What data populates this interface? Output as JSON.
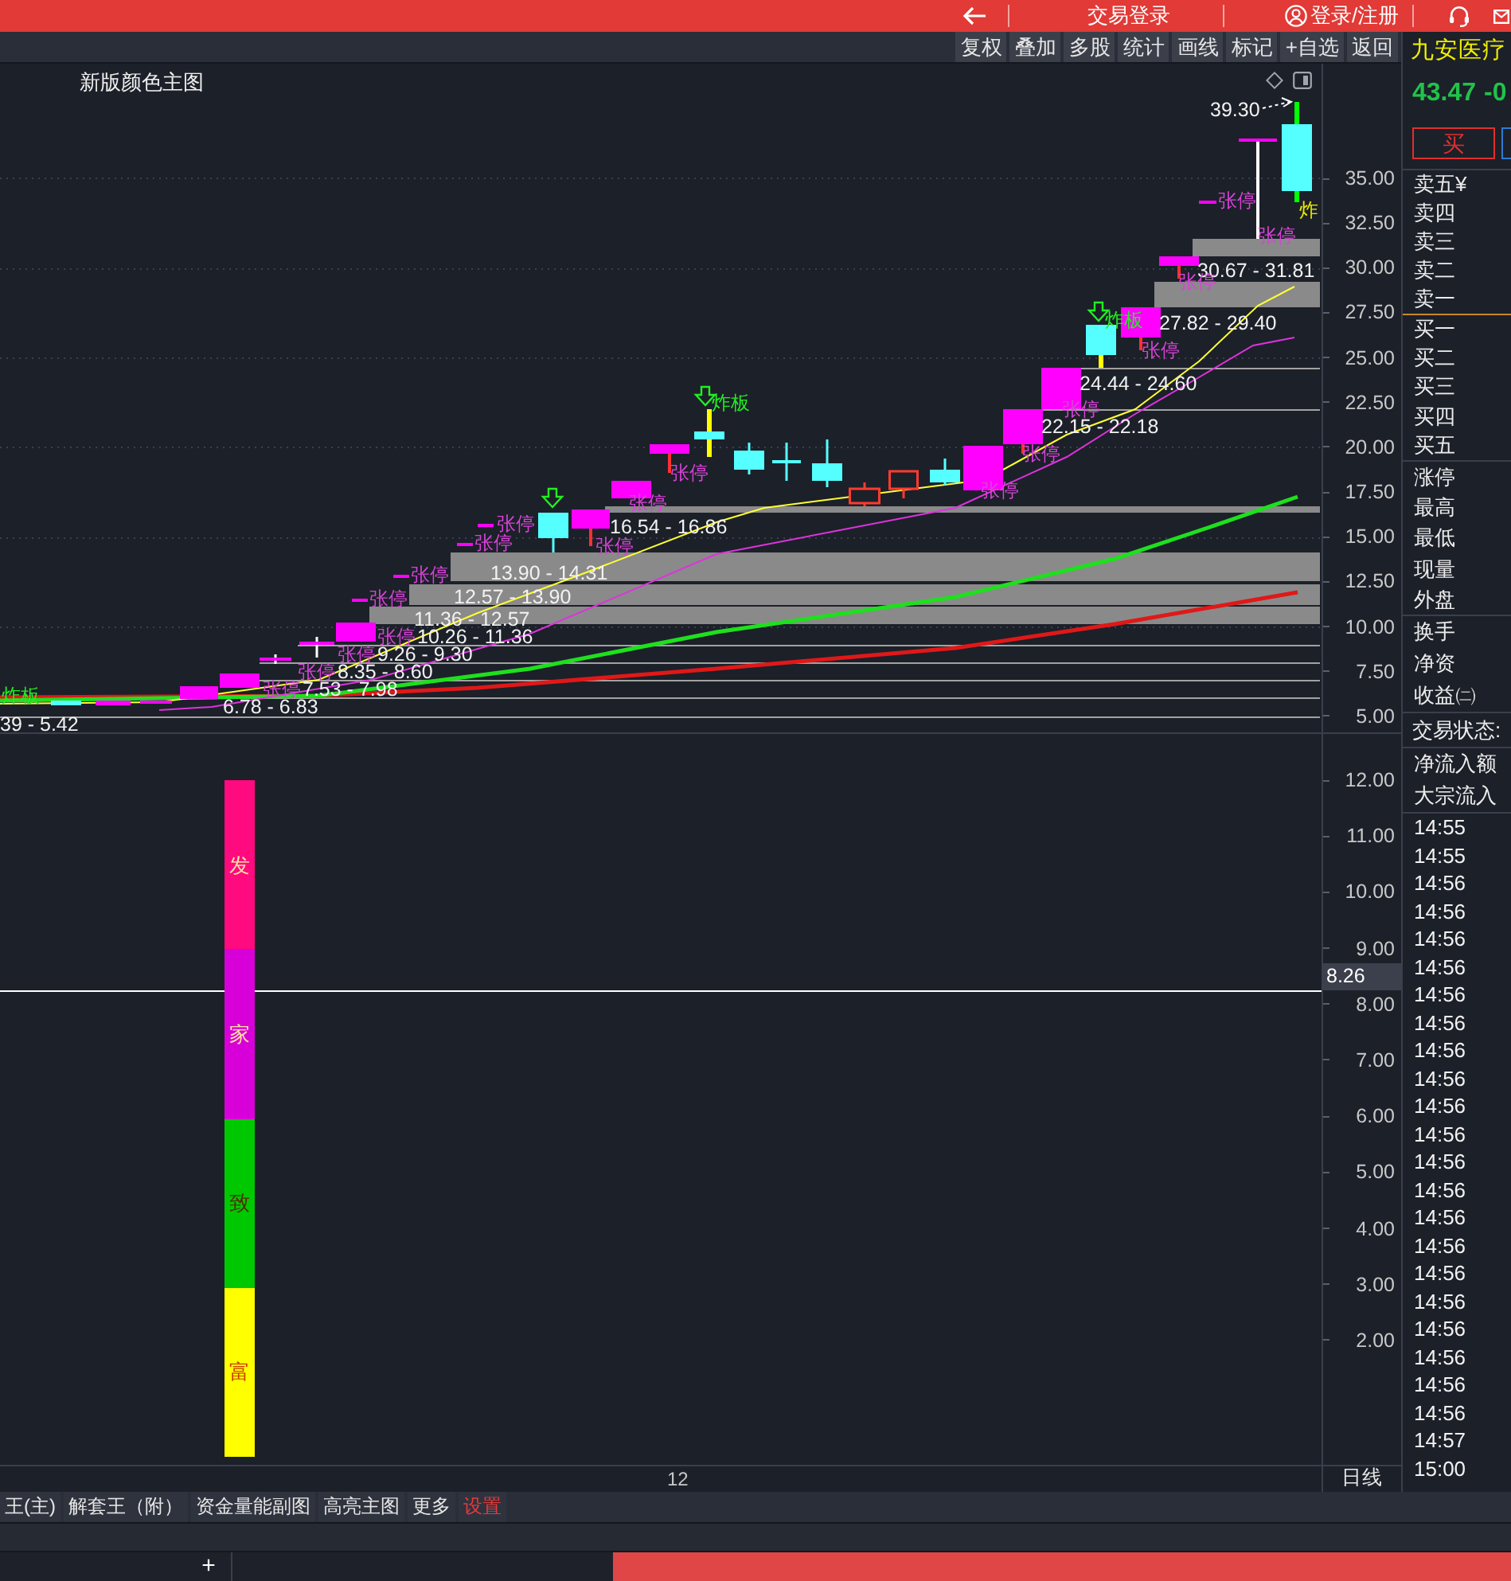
{
  "header": {
    "trade_login": "交易登录",
    "login_register": "登录/注册"
  },
  "toolbar": {
    "buttons": [
      "复权",
      "叠加",
      "多股",
      "统计",
      "画线",
      "标记",
      "+自选",
      "返回"
    ]
  },
  "main_chart": {
    "title": "新版颜色主图",
    "high_price": "39.30",
    "limit_up_labels": [
      "张停",
      "张停",
      "张停",
      "张停",
      "张停",
      "张停",
      "张停",
      "张停",
      "张停",
      "张停",
      "张停",
      "张停",
      "张停",
      "张停",
      "张停",
      "张停",
      "张停",
      "张停"
    ],
    "board_break_labels": [
      {
        "text": "炸",
        "color": "#e8e800"
      },
      {
        "text": "炸板",
        "color": "#22ee22"
      },
      {
        "text": "炸板",
        "color": "#22ee22"
      },
      {
        "text": "炸板",
        "color": "#22ee22"
      }
    ],
    "price_ranges": [
      "30.67 - 31.81",
      "27.82 - 29.40",
      "24.44 - 24.60",
      "22.15 - 22.18",
      "16.54 - 16.86",
      "13.90 - 14.31",
      "12.57 - 13.90",
      "11.36 - 12.57",
      "10.26 - 11.36",
      "9.26 - 9.30",
      "8.35 - 8.60",
      "7.53 - 7.98",
      "6.78 - 6.83",
      "39 - 5.42"
    ],
    "price_axis": [
      "35.00",
      "32.50",
      "30.00",
      "27.50",
      "25.00",
      "22.50",
      "20.00",
      "17.50",
      "15.00",
      "12.50",
      "10.00",
      "7.50",
      "5.00"
    ]
  },
  "indicator": {
    "segments": [
      {
        "label": "发",
        "color": "#ff0a7f"
      },
      {
        "label": "家",
        "color": "#d800d8"
      },
      {
        "label": "致",
        "color": "#00c800"
      },
      {
        "label": "富",
        "color": "#ffff00"
      }
    ],
    "crosshair_value": "8.26",
    "value_axis": [
      "12.00",
      "11.00",
      "10.00",
      "9.00",
      "8.00",
      "7.00",
      "6.00",
      "5.00",
      "4.00",
      "3.00",
      "2.00"
    ]
  },
  "x_axis": {
    "date_label": "12",
    "period": "日线"
  },
  "quote_panel": {
    "stock_name": "九安医疗",
    "price": "43.47",
    "change": "-0",
    "buy_button": "买",
    "asks": [
      "卖五¥",
      "卖四",
      "卖三",
      "卖二",
      "卖一"
    ],
    "bids": [
      "买一",
      "买二",
      "买三",
      "买四",
      "买五"
    ],
    "stats": [
      "涨停",
      "最高",
      "最低",
      "现量",
      "外盘"
    ],
    "ratios": [
      "换手",
      "净资",
      "收益㈡"
    ],
    "trade_status": "交易状态:",
    "flows": [
      "净流入额",
      "大宗流入"
    ],
    "tick_times": [
      "14:55",
      "14:55",
      "14:56",
      "14:56",
      "14:56",
      "14:56",
      "14:56",
      "14:56",
      "14:56",
      "14:56",
      "14:56",
      "14:56",
      "14:56",
      "14:56",
      "14:56",
      "14:56",
      "14:56",
      "14:56",
      "14:56",
      "14:56",
      "14:56",
      "14:56",
      "14:57",
      "15:00"
    ]
  },
  "bottom_tabs": [
    {
      "label": "王(主)",
      "color": "#e6e6e6"
    },
    {
      "label": "解套王（附）",
      "color": "#e6e6e6"
    },
    {
      "label": "资金量能副图",
      "color": "#e6e6e6"
    },
    {
      "label": "高亮主图",
      "color": "#e6e6e6"
    },
    {
      "label": "更多",
      "color": "#e6e6e6"
    },
    {
      "label": "设置",
      "color": "#e8393a"
    }
  ],
  "footer": {
    "add_button": "+"
  }
}
